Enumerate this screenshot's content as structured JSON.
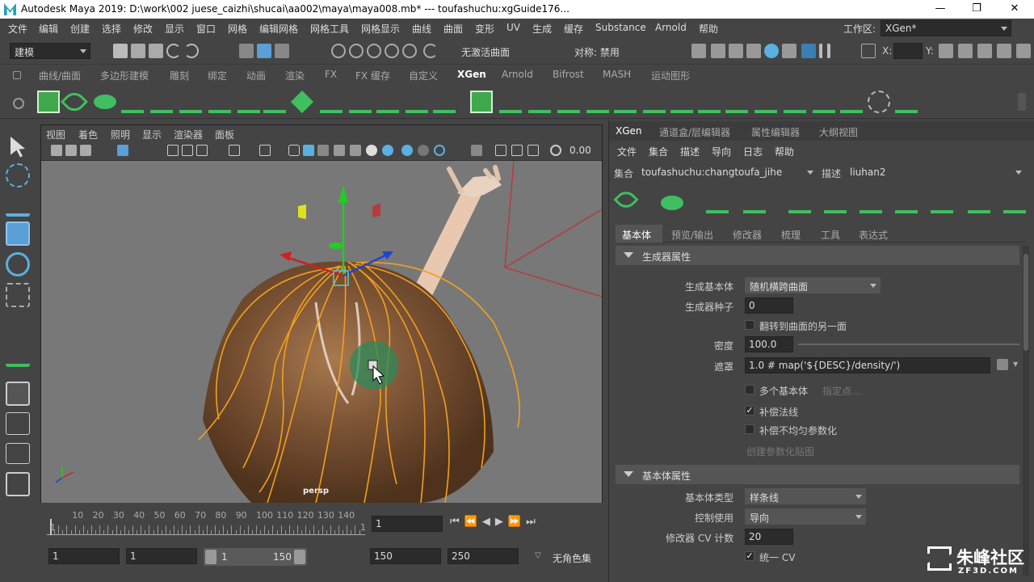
{
  "title_bar": {
    "title": "Autodesk Maya 2019: D:\\work\\002 juese_caizhi\\shucai\\aa002\\maya\\maya008.mb*   ---   toufashuchu:xgGuide176...",
    "minimize": "—",
    "restore": "❐",
    "close": "✕"
  },
  "menu": [
    "文件",
    "编辑",
    "创建",
    "选择",
    "修改",
    "显示",
    "窗口",
    "网格",
    "编辑网格",
    "网格工具",
    "网格显示",
    "曲线",
    "曲面",
    "变形",
    "UV",
    "生成",
    "缓存",
    "Substance",
    "Arnold",
    "帮助"
  ],
  "workspace": {
    "label": "工作区:",
    "value": "XGen*"
  },
  "status_line": {
    "mode": "建模",
    "live_surface": "无激活曲面",
    "symmetry": "对称: 禁用",
    "x_label": "X:",
    "y_label": "Y:"
  },
  "shelf_tabs": [
    "曲线/曲面",
    "多边形建模",
    "雕刻",
    "绑定",
    "动画",
    "渲染",
    "FX",
    "FX 缓存",
    "自定义",
    "XGen",
    "Arnold",
    "Bifrost",
    "MASH",
    "运动图形"
  ],
  "shelf_active": "XGen",
  "viewport": {
    "menu": [
      "视图",
      "着色",
      "照明",
      "显示",
      "渲染器",
      "面板"
    ],
    "camera_value": "0.00",
    "camera_name": "persp"
  },
  "timeline": {
    "ticks": [
      "1",
      "10",
      "20",
      "30",
      "40",
      "50",
      "60",
      "70",
      "80",
      "90",
      "100",
      "110",
      "120",
      "130",
      "140",
      "1"
    ],
    "current_frame": "1"
  },
  "range": {
    "start": "1",
    "inner_start": "1",
    "slider_start": "1",
    "slider_end": "150",
    "inner_end": "150",
    "end": "250",
    "character_set": "无角色集"
  },
  "xgen_panel": {
    "tabs": [
      "XGen",
      "通道盒/层编辑器",
      "属性编辑器",
      "大纲视图"
    ],
    "menu": [
      "文件",
      "集合",
      "描述",
      "导向",
      "日志",
      "帮助"
    ],
    "collection_label": "集合",
    "collection_value": "toufashuchu:changtoufa_jihe",
    "description_label": "描述",
    "description_value": "liuhan2",
    "sub_tabs": [
      "基本体",
      "预览/输出",
      "修改器",
      "梳理",
      "工具",
      "表达式"
    ],
    "generator_section": "生成器属性",
    "generator_label": "生成基本体",
    "generator_value": "随机横跨曲面",
    "seed_label": "生成器种子",
    "seed_value": "0",
    "flip_label": "翻转到曲面的另一面",
    "density_label": "密度",
    "density_value": "100.0",
    "mask_label": "遮罩",
    "mask_value": "1.0 # map('${DESC}/density/')",
    "multi_label": "多个基本体",
    "specify_points": "指定点...",
    "comp_normals_label": "补偿法线",
    "comp_param_label": "补偿不均匀参数化",
    "create_param_map": "创建参数化贴图",
    "primitive_section": "基本体属性",
    "prim_type_label": "基本体类型",
    "prim_type_value": "样条线",
    "control_label": "控制使用",
    "control_value": "导向",
    "cv_count_label": "修改器 CV 计数",
    "cv_count_value": "20",
    "unify_cv_label": "统一 CV"
  },
  "watermark": {
    "cn": "朱峰社区",
    "en": "ZF3D.COM"
  },
  "colors": {
    "xgen_green": "#3fbf5f",
    "accent_blue": "#5a9fd6",
    "hair_orange": "#f0a020",
    "bg": "#444444"
  }
}
